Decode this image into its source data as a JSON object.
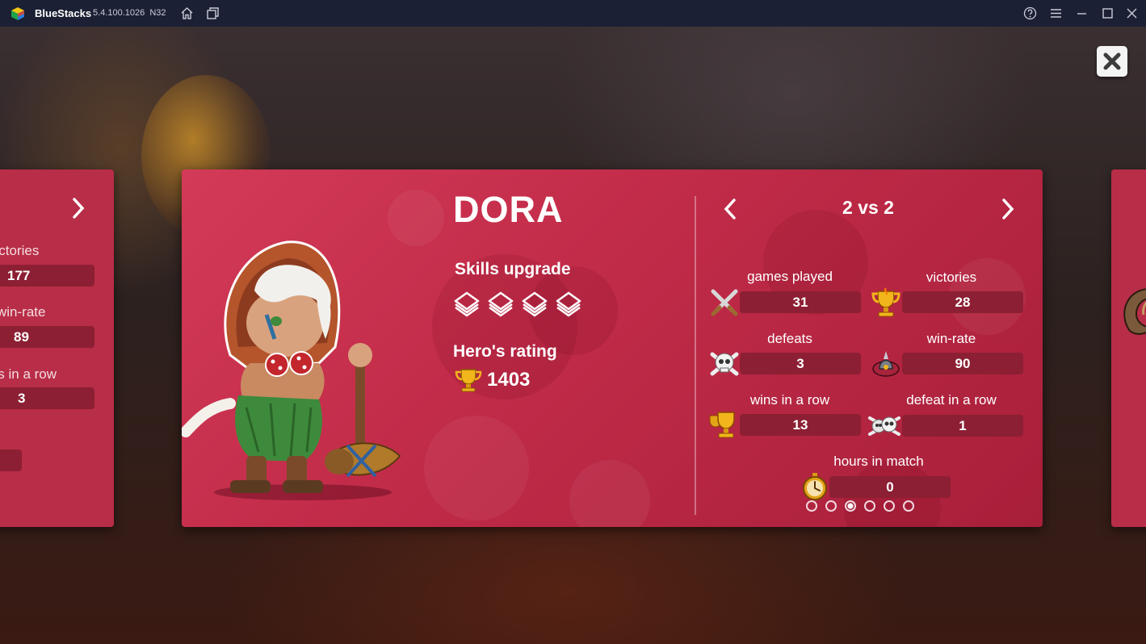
{
  "window": {
    "app_name": "BlueStacks",
    "version": "5.4.100.1026",
    "build_tag": "N32",
    "icons": [
      "bluestacks-logo",
      "home-icon",
      "multi-instance-icon",
      "help-icon",
      "menu-icon",
      "minimize-icon",
      "maximize-icon",
      "close-icon"
    ]
  },
  "colors": {
    "card": "#c22c49",
    "pill": "#8c1f33",
    "titlebar": "#1b2034"
  },
  "left_card": {
    "rows": [
      {
        "label": "victories",
        "value": "177"
      },
      {
        "label": "win-rate",
        "value": "89"
      },
      {
        "label": "defeats in a row",
        "value": "3"
      }
    ]
  },
  "hero": {
    "name": "DORA",
    "skills_label": "Skills upgrade",
    "skills_upgraded": 4,
    "rating_label": "Hero's rating",
    "rating_value": "1403"
  },
  "stats": {
    "mode": "2 vs 2",
    "items": [
      {
        "label": "games played",
        "value": "31",
        "icon": "crossed-swords-icon"
      },
      {
        "label": "victories",
        "value": "28",
        "icon": "gold-trophy-icon"
      },
      {
        "label": "defeats",
        "value": "3",
        "icon": "skull-crossbones-icon"
      },
      {
        "label": "win-rate",
        "value": "90",
        "icon": "helmet-emblem-icon"
      },
      {
        "label": "wins in a row",
        "value": "13",
        "icon": "double-trophy-icon"
      },
      {
        "label": "defeat in a row",
        "value": "1",
        "icon": "double-skull-icon"
      },
      {
        "label": "hours in match",
        "value": "0",
        "icon": "stopwatch-icon"
      }
    ],
    "page_count": 6,
    "active_page": 3
  }
}
